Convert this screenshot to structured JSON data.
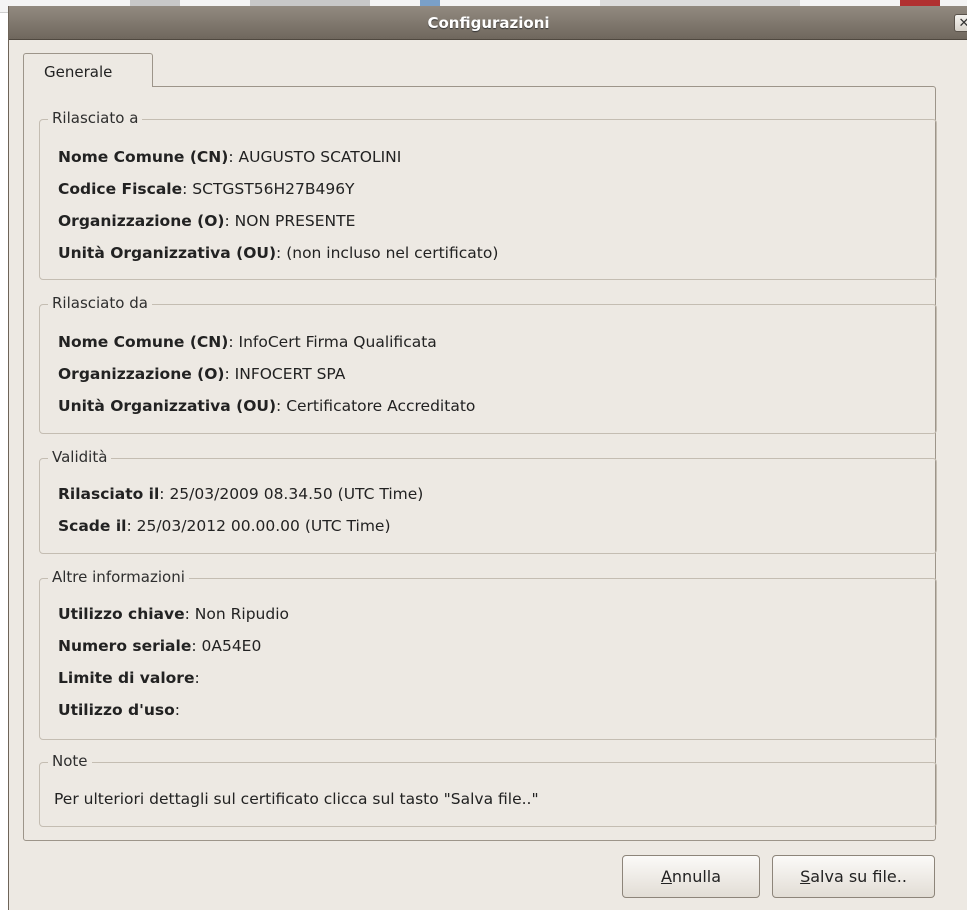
{
  "window": {
    "title": "Configurazioni",
    "close_glyph": "✕"
  },
  "tabs": [
    {
      "label": "Generale",
      "selected": true
    }
  ],
  "sections": {
    "issued_to": {
      "title": "Rilasciato a",
      "rows": [
        {
          "label": "Nome Comune (CN)",
          "value": ": AUGUSTO SCATOLINI"
        },
        {
          "label": "Codice Fiscale",
          "value": ": SCTGST56H27B496Y"
        },
        {
          "label": "Organizzazione (O)",
          "value": ": NON PRESENTE"
        },
        {
          "label": "Unità Organizzativa (OU)",
          "value": ": (non incluso nel certificato)"
        }
      ]
    },
    "issued_by": {
      "title": "Rilasciato da",
      "rows": [
        {
          "label": "Nome Comune (CN)",
          "value": ": InfoCert Firma Qualificata"
        },
        {
          "label": "Organizzazione (O)",
          "value": ": INFOCERT SPA"
        },
        {
          "label": "Unità Organizzativa (OU)",
          "value": ": Certificatore Accreditato"
        }
      ]
    },
    "validity": {
      "title": "Validità",
      "rows": [
        {
          "label": "Rilasciato il",
          "value": ": 25/03/2009 08.34.50 (UTC Time)"
        },
        {
          "label": "Scade il",
          "value": ": 25/03/2012 00.00.00 (UTC Time)"
        }
      ]
    },
    "other_info": {
      "title": "Altre informazioni",
      "rows": [
        {
          "label": "Utilizzo chiave",
          "value": ": Non Ripudio"
        },
        {
          "label": "Numero seriale",
          "value": ": 0A54E0"
        },
        {
          "label": "Limite di valore",
          "value": ":"
        },
        {
          "label": "Utilizzo d'uso",
          "value": ":"
        }
      ]
    },
    "note": {
      "title": "Note",
      "text": "Per ulteriori dettagli sul certificato clicca sul tasto \"Salva file..\""
    }
  },
  "buttons": {
    "cancel": {
      "mnemonic": "A",
      "rest": "nnulla"
    },
    "save": {
      "mnemonic": "S",
      "rest": "alva su file.."
    }
  }
}
